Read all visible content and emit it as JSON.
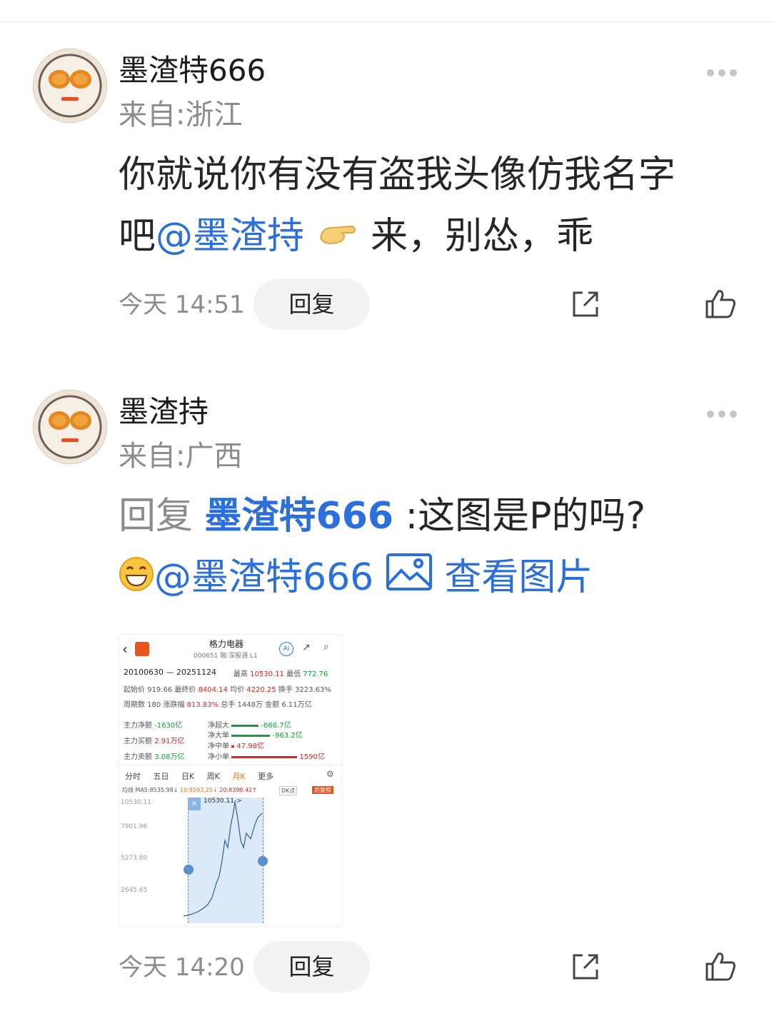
{
  "comments": [
    {
      "username": "墨渣特666",
      "location": "来自:浙江",
      "line1": "你就说你有没有盗我头像仿我名字",
      "line2_prefix": "吧",
      "mention": "@墨渣持",
      "line2_suffix": "来，别怂，乖",
      "time": "今天 14:51",
      "reply_label": "回复"
    },
    {
      "username": "墨渣持",
      "location": "来自:广西",
      "reply_word": "回复",
      "reply_target": "墨渣特666",
      "reply_text": ":这图是P的吗?",
      "mention": "@墨渣特666",
      "view_image": "查看图片",
      "time": "今天 14:20",
      "reply_label": "回复"
    }
  ],
  "stock": {
    "name": "格力电器",
    "code": "000651",
    "tags": "融 深股通 L1",
    "range": "20100630 — 20251124",
    "high_label": "最高",
    "high": "10530.11",
    "low_label": "最低",
    "low": "772.76",
    "start_label": "起始价",
    "start": "919.66",
    "end_label": "最终价",
    "end": "8404.14",
    "avg_label": "均价",
    "avg": "4220.25",
    "turnover_label": "换手",
    "turnover": "3223.63%",
    "periods_label": "周期数",
    "periods": "180",
    "change_label": "涨跌幅",
    "change": "813.83%",
    "hands_label": "总手",
    "hands": "1448万",
    "amount_label": "金额",
    "amount": "6.11万亿",
    "main_net_label": "主力净额",
    "main_net": "-1630亿",
    "main_buy_label": "主力买额",
    "main_buy": "2.91万亿",
    "main_sell_label": "主力卖额",
    "main_sell": "3.08万亿",
    "super_label": "净超大",
    "super": "-666.7亿",
    "large_label": "净大单",
    "large": "-963.2亿",
    "mid_label": "净中单",
    "mid": "47.98亿",
    "small_label": "净小单",
    "small": "1590亿",
    "tabs": [
      "分时",
      "五日",
      "日K",
      "周K",
      "月K",
      "更多"
    ],
    "ma_line": "均线",
    "ma5": "MA5:8535.98↓",
    "ma10": "10:8593.25↓",
    "ma20": "20:8399.42↑",
    "dk": "DK点",
    "adjust": "后复权",
    "y_ticks": [
      "10530.11",
      "7901.96",
      "5273.80",
      "2645.65"
    ],
    "marker": "10530.11->"
  }
}
